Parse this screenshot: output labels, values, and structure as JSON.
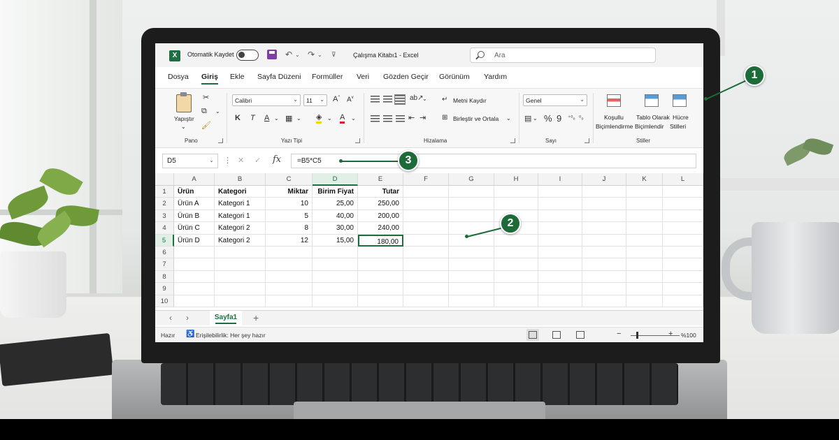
{
  "titlebar": {
    "autosave_label": "Otomatik Kaydet",
    "doc_title": "Çalışma Kitabı1  -  Excel",
    "search_placeholder": "Ara"
  },
  "tabs": [
    "Dosya",
    "Giriş",
    "Ekle",
    "Sayfa Düzeni",
    "Formüller",
    "Veri",
    "Gözden Geçir",
    "Görünüm",
    "Yardım"
  ],
  "active_tab": "Giriş",
  "ribbon": {
    "clipboard": {
      "paste_label": "Yapıştır",
      "group_label": "Pano"
    },
    "font": {
      "font_name": "Calibri",
      "font_size": "11",
      "bold": "K",
      "italic": "T",
      "underline": "A",
      "group_label": "Yazı Tipi"
    },
    "alignment": {
      "wrap_text": "Metni Kaydır",
      "merge_center": "Birleştir ve Ortala",
      "group_label": "Hizalama"
    },
    "number": {
      "format": "Genel",
      "percent": "%",
      "comma": "9",
      "group_label": "Sayı"
    },
    "styles": {
      "conditional": [
        "Koşullu",
        "Biçimlendirme"
      ],
      "format_table": [
        "Tablo Olarak",
        "Biçimlendir"
      ],
      "cell_styles": [
        "Hücre",
        "Stilleri"
      ],
      "group_label": "Stiller"
    }
  },
  "formula_bar": {
    "name_box": "D5",
    "fx_label": "fx",
    "formula": "=B5*C5"
  },
  "grid": {
    "columns": [
      "A",
      "B",
      "C",
      "D",
      "E",
      "F",
      "G",
      "H",
      "I",
      "J",
      "K",
      "L"
    ],
    "rows": [
      "1",
      "2",
      "3",
      "4",
      "5",
      "6",
      "7",
      "8",
      "9",
      "10"
    ],
    "header_row": [
      "Ürün",
      "Kategori",
      "Miktar",
      "Birim Fiyat",
      "Tutar"
    ],
    "data_rows": [
      [
        "Ürün A",
        "Kategori 1",
        "10",
        "25,00",
        "250,00"
      ],
      [
        "Ürün B",
        "Kategori 1",
        "5",
        "40,00",
        "200,00"
      ],
      [
        "Ürün C",
        "Kategori 2",
        "8",
        "30,00",
        "240,00"
      ],
      [
        "Ürün D",
        "Kategori 2",
        "12",
        "15,00",
        "180,00"
      ]
    ]
  },
  "sheet": {
    "tab_name": "Sayfa1",
    "add": "+"
  },
  "status": {
    "ready": "Hazır",
    "accessibility": "Erişilebilirlik: Her şey hazır",
    "zoom": "%100"
  },
  "callouts": [
    "1",
    "2",
    "3"
  ],
  "colors": {
    "excel_green": "#1d6f42",
    "callout_green": "#1e6b3a"
  }
}
